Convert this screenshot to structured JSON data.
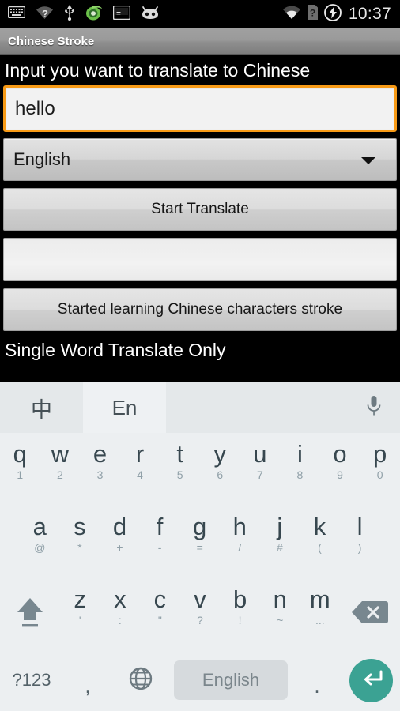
{
  "status_bar": {
    "icons_left": [
      "keyboard-icon",
      "wifi-question-icon",
      "usb-icon",
      "download-manager-icon",
      "terminal-icon",
      "cyanogenmod-icon"
    ],
    "icons_right": [
      "wifi-signal-icon",
      "sim-question-icon",
      "charging-bolt-icon"
    ],
    "clock": "10:37"
  },
  "title_bar": {
    "title": "Chinese Stroke"
  },
  "app": {
    "prompt_label": "Input you want to translate to Chinese",
    "input": {
      "value": "hello",
      "placeholder": "",
      "focus_color": "#f79a16"
    },
    "language_spinner": {
      "selected": "English",
      "options": [
        "English"
      ]
    },
    "translate_button": "Start Translate",
    "output_field": {
      "value": ""
    },
    "learn_button": "Started learning Chinese characters stroke",
    "footnote": "Single Word Translate Only"
  },
  "keyboard": {
    "toolbar": {
      "tab_chinese": "中",
      "tab_english": "En",
      "active_tab": "En",
      "mic": "microphone-icon"
    },
    "row1": [
      {
        "main": "q",
        "sub": "1"
      },
      {
        "main": "w",
        "sub": "2"
      },
      {
        "main": "e",
        "sub": "3"
      },
      {
        "main": "r",
        "sub": "4"
      },
      {
        "main": "t",
        "sub": "5"
      },
      {
        "main": "y",
        "sub": "6"
      },
      {
        "main": "u",
        "sub": "7"
      },
      {
        "main": "i",
        "sub": "8"
      },
      {
        "main": "o",
        "sub": "9"
      },
      {
        "main": "p",
        "sub": "0"
      }
    ],
    "row2": [
      {
        "main": "a",
        "sub": "@"
      },
      {
        "main": "s",
        "sub": "*"
      },
      {
        "main": "d",
        "sub": "+"
      },
      {
        "main": "f",
        "sub": "-"
      },
      {
        "main": "g",
        "sub": "="
      },
      {
        "main": "h",
        "sub": "/"
      },
      {
        "main": "j",
        "sub": "#"
      },
      {
        "main": "k",
        "sub": "("
      },
      {
        "main": "l",
        "sub": ")"
      }
    ],
    "row3": [
      {
        "main": "z",
        "sub": "'"
      },
      {
        "main": "x",
        "sub": ":"
      },
      {
        "main": "c",
        "sub": "\""
      },
      {
        "main": "v",
        "sub": "?"
      },
      {
        "main": "b",
        "sub": "!"
      },
      {
        "main": "n",
        "sub": "~"
      },
      {
        "main": "m",
        "sub": "..."
      }
    ],
    "shift_key": "shift-icon",
    "delete_key": "backspace-icon",
    "row4": {
      "symbols_key": "?123",
      "comma_key": ",",
      "globe_key": "globe-icon",
      "space_key": "English",
      "period_key": ".",
      "enter_key": "enter-icon",
      "enter_color": "#3ba293"
    }
  }
}
